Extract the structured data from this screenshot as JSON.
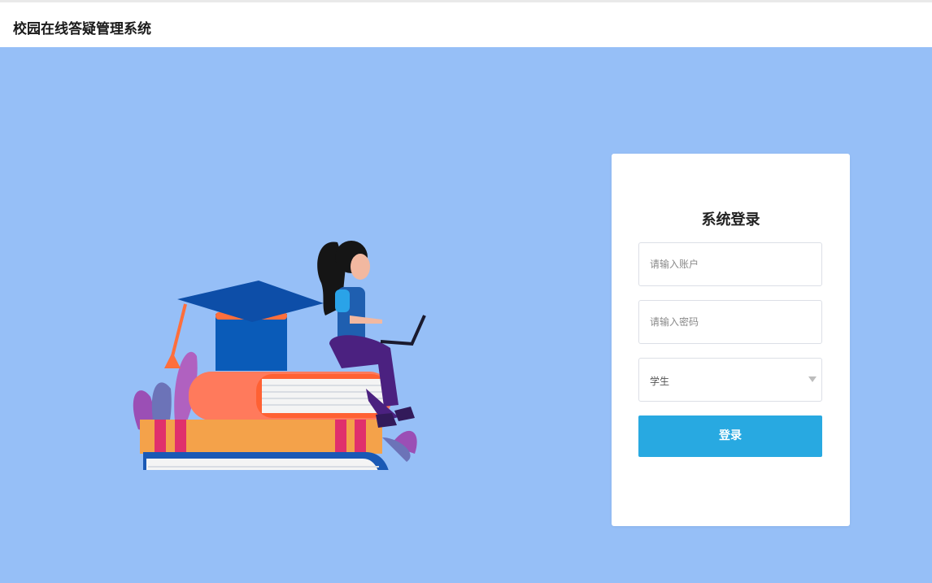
{
  "header": {
    "app_title": "校园在线答疑管理系统"
  },
  "login": {
    "title": "系统登录",
    "account_placeholder": "请输入账户",
    "password_placeholder": "请输入密码",
    "role_selected": "学生",
    "submit_label": "登录"
  },
  "colors": {
    "background": "#96bff7",
    "primary_button": "#28a9e1",
    "card": "#ffffff"
  },
  "illustration": {
    "description_icon": "student-on-books-illustration"
  }
}
